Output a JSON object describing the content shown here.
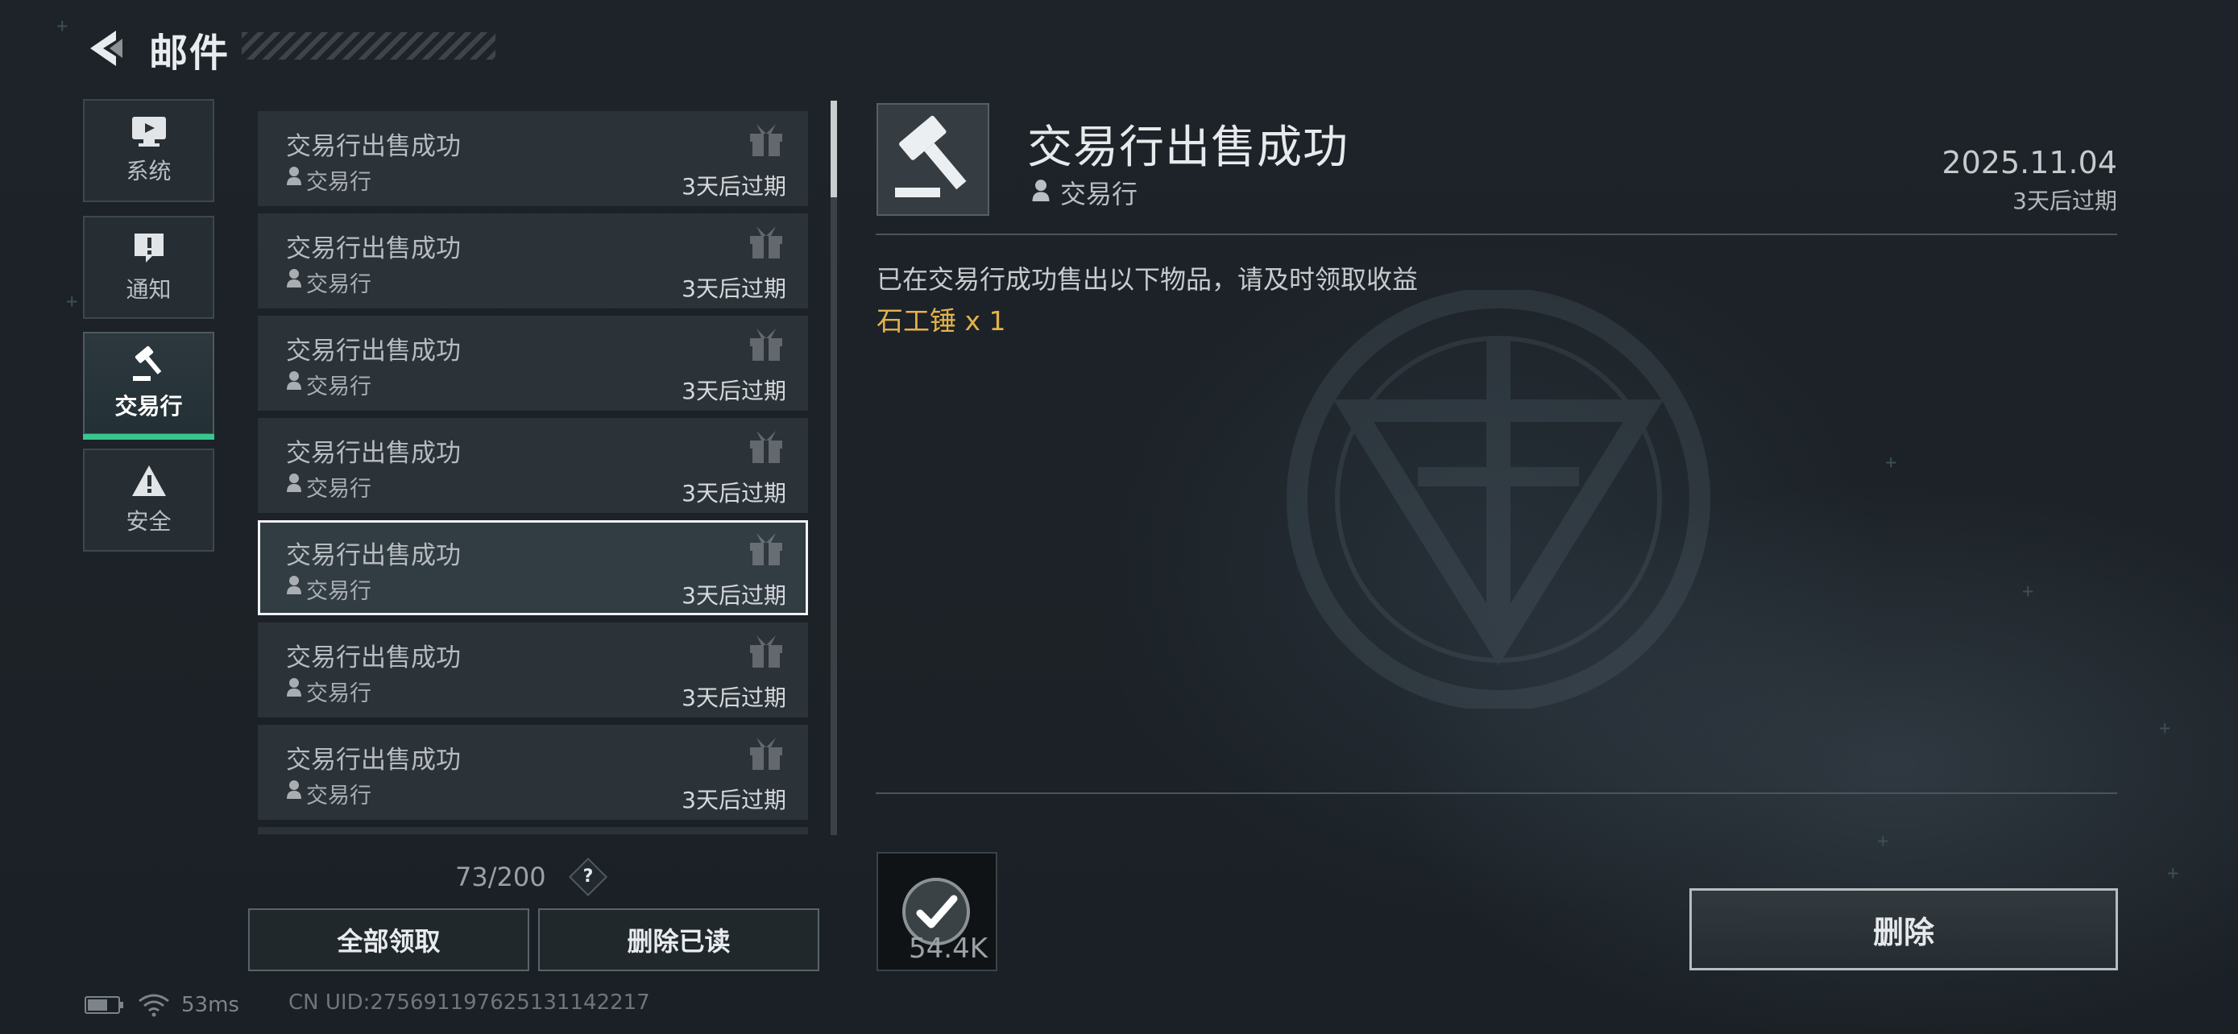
{
  "header": {
    "title": "邮件"
  },
  "categories": [
    {
      "label": "系统",
      "icon": "monitor-icon"
    },
    {
      "label": "通知",
      "icon": "exclamation-bubble-icon"
    },
    {
      "label": "交易行",
      "icon": "gavel-icon",
      "active": true
    },
    {
      "label": "安全",
      "icon": "warning-triangle-icon"
    }
  ],
  "mail_list": {
    "items": [
      {
        "title": "交易行出售成功",
        "sender": "交易行",
        "expire": "3天后过期"
      },
      {
        "title": "交易行出售成功",
        "sender": "交易行",
        "expire": "3天后过期"
      },
      {
        "title": "交易行出售成功",
        "sender": "交易行",
        "expire": "3天后过期"
      },
      {
        "title": "交易行出售成功",
        "sender": "交易行",
        "expire": "3天后过期"
      },
      {
        "title": "交易行出售成功",
        "sender": "交易行",
        "expire": "3天后过期",
        "selected": true
      },
      {
        "title": "交易行出售成功",
        "sender": "交易行",
        "expire": "3天后过期"
      },
      {
        "title": "交易行出售成功",
        "sender": "交易行",
        "expire": "3天后过期"
      }
    ],
    "capacity": "73/200",
    "help_label": "?",
    "claim_all_label": "全部领取",
    "delete_read_label": "删除已读"
  },
  "status": {
    "ping": "53ms",
    "uid": "CN UID:275691197625131142217"
  },
  "detail": {
    "title": "交易行出售成功",
    "sender": "交易行",
    "date": "2025.11.04",
    "expire": "3天后过期",
    "body": "已在交易行成功售出以下物品，请及时领取收益",
    "item_line": "石工锤 x 1",
    "reward_amount": "54.4K",
    "delete_label": "删除"
  },
  "colors": {
    "accent_green": "#39c68f",
    "item_gold": "#e3b24b"
  }
}
